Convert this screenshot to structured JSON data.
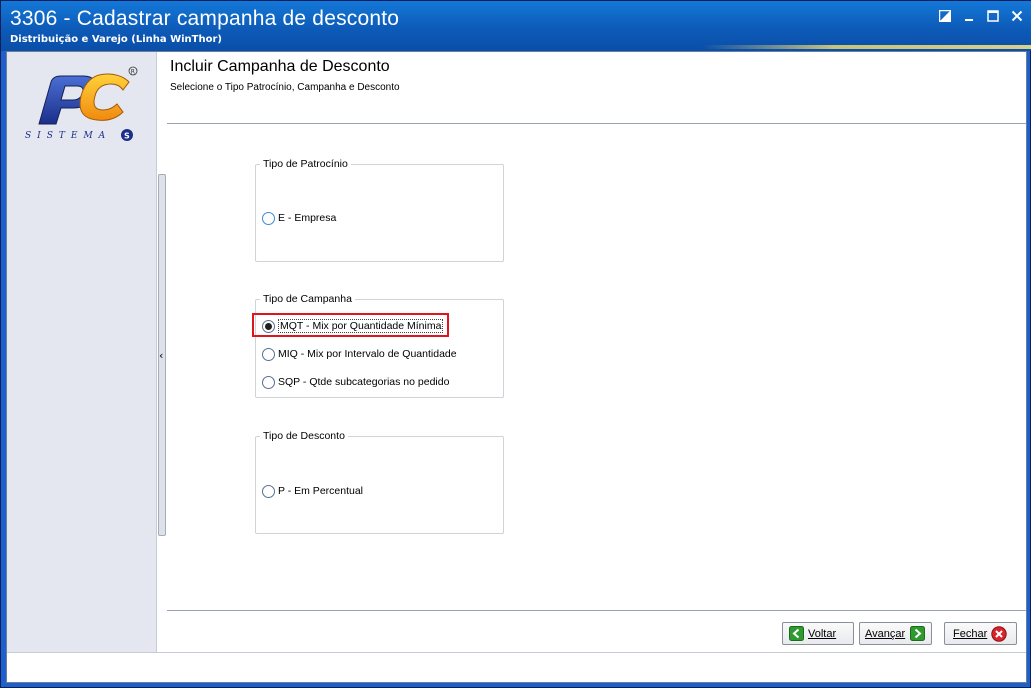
{
  "window": {
    "title": "3306 - Cadastrar campanha de desconto",
    "subtitle": "Distribuição e Varejo (Linha WinThor)"
  },
  "logo": {
    "text": "PC",
    "tagline": "SISTEMAS",
    "registered": "®"
  },
  "header": {
    "title": "Incluir Campanha de Desconto",
    "subtitle": "Selecione o Tipo Patrocínio, Campanha e Desconto"
  },
  "groups": {
    "patrocinio": {
      "legend": "Tipo de Patrocínio",
      "options": [
        {
          "label": "E - Empresa",
          "selected": false
        }
      ]
    },
    "campanha": {
      "legend": "Tipo de Campanha",
      "options": [
        {
          "label": "MQT - Mix por Quantidade Mínima",
          "selected": true
        },
        {
          "label": "MIQ - Mix por Intervalo de Quantidade",
          "selected": false
        },
        {
          "label": "SQP - Qtde subcategorias no pedido",
          "selected": false
        }
      ]
    },
    "desconto": {
      "legend": "Tipo de Desconto",
      "options": [
        {
          "label": "P - Em Percentual",
          "selected": false
        }
      ]
    }
  },
  "buttons": {
    "voltar": "Voltar",
    "avancar": "Avançar",
    "fechar": "Fechar"
  },
  "sidebar": {
    "collapse_glyph": "‹"
  },
  "colors": {
    "titlebar": "#0d5bb8",
    "highlight": "#e1141c",
    "nav_green": "#2f9a2f",
    "close_red": "#d8252b"
  },
  "icons": [
    "restore-icon",
    "minimize-icon",
    "maximize-icon",
    "close-icon",
    "back-arrow-icon",
    "forward-arrow-icon",
    "close-circle-icon"
  ]
}
